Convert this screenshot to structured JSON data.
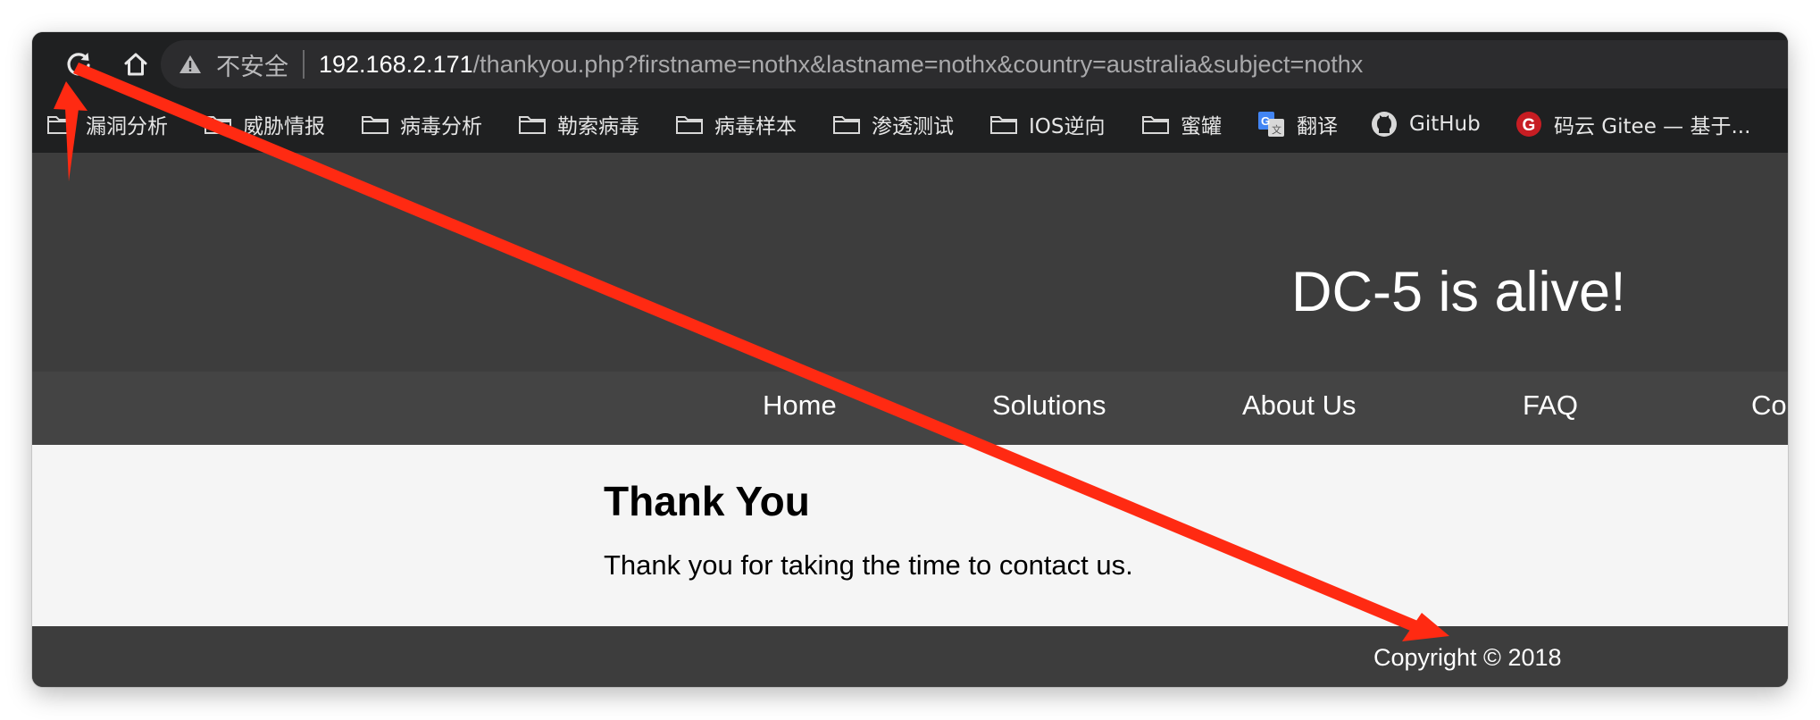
{
  "browser": {
    "insecure_label": "不安全",
    "url_host": "192.168.2.171",
    "url_path": "/thankyou.php?firstname=nothx&lastname=nothx&country=australia&subject=nothx",
    "bookmarks": [
      {
        "label": "漏洞分析",
        "icon": "folder-icon"
      },
      {
        "label": "威胁情报",
        "icon": "folder-icon"
      },
      {
        "label": "病毒分析",
        "icon": "folder-icon"
      },
      {
        "label": "勒索病毒",
        "icon": "folder-icon"
      },
      {
        "label": "病毒样本",
        "icon": "folder-icon"
      },
      {
        "label": "渗透测试",
        "icon": "folder-icon"
      },
      {
        "label": "IOS逆向",
        "icon": "folder-icon"
      },
      {
        "label": "蜜罐",
        "icon": "folder-icon"
      },
      {
        "label": "翻译",
        "icon": "google-translate-icon"
      },
      {
        "label": "GitHub",
        "icon": "github-icon"
      },
      {
        "label": "码云 Gitee — 基于...",
        "icon": "gitee-icon"
      }
    ]
  },
  "site": {
    "title": "DC-5 is alive!",
    "nav": [
      "Home",
      "Solutions",
      "About Us",
      "FAQ",
      "Co"
    ],
    "heading": "Thank You",
    "message": "Thank you for taking the time to contact us.",
    "footer": "Copyright © 2018"
  },
  "colors": {
    "annotation_arrow": "#ff2a12",
    "toolbar": "#1f2021",
    "header": "#3d3d3d",
    "nav": "#444444",
    "content": "#f5f5f5"
  }
}
